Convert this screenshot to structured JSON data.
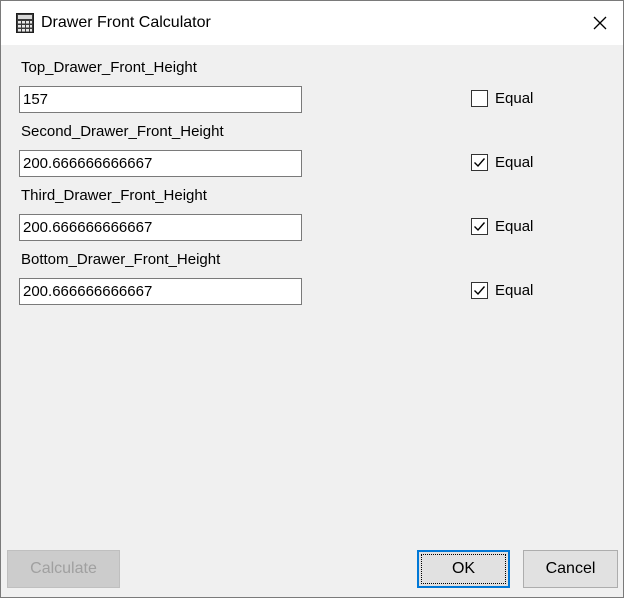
{
  "window": {
    "title": "Drawer Front Calculator",
    "icon": "calculator-icon",
    "close_icon": "close-icon"
  },
  "fields": [
    {
      "label": "Top_Drawer_Front_Height",
      "value": "157",
      "equal_label": "Equal",
      "equal_checked": false
    },
    {
      "label": "Second_Drawer_Front_Height",
      "value": "200.666666666667",
      "equal_label": "Equal",
      "equal_checked": true
    },
    {
      "label": "Third_Drawer_Front_Height",
      "value": "200.666666666667",
      "equal_label": "Equal",
      "equal_checked": true
    },
    {
      "label": "Bottom_Drawer_Front_Height",
      "value": "200.666666666667",
      "equal_label": "Equal",
      "equal_checked": true
    }
  ],
  "buttons": {
    "calculate": "Calculate",
    "ok": "OK",
    "cancel": "Cancel"
  },
  "colors": {
    "accent": "#0078d7",
    "dialog_bg": "#f0f0f0"
  }
}
